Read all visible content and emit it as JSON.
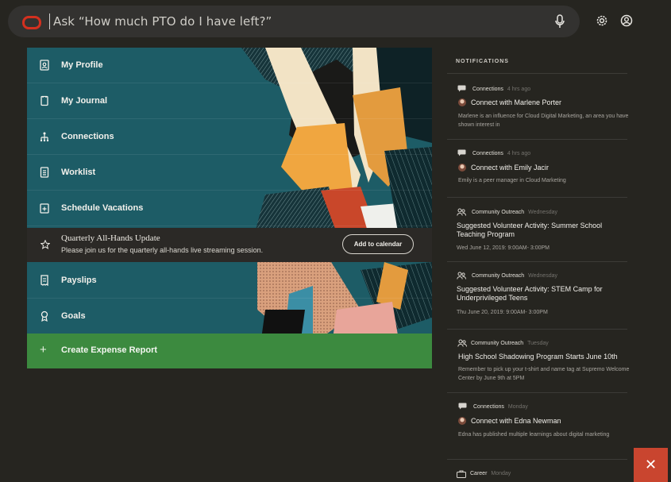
{
  "search": {
    "placeholder": "Ask “How much PTO do I have left?”"
  },
  "menu": {
    "items": [
      {
        "label": "My Profile",
        "icon": "profile-icon"
      },
      {
        "label": "My Journal",
        "icon": "journal-icon"
      },
      {
        "label": "Connections",
        "icon": "connections-icon"
      },
      {
        "label": "Worklist",
        "icon": "worklist-icon"
      },
      {
        "label": "Schedule Vacations",
        "icon": "calendar-plus-icon"
      },
      {
        "label": "Payslips",
        "icon": "payslip-icon"
      },
      {
        "label": "Goals",
        "icon": "goals-icon"
      }
    ],
    "announcement": {
      "title": "Quarterly All-Hands Update",
      "subtitle": "Please join us for the quarterly all-hands live streaming session.",
      "button": "Add to calendar"
    },
    "expense": {
      "label": "Create Expense Report",
      "icon": "plus-icon"
    }
  },
  "notifications": {
    "header": "NOTIFICATIONS",
    "items": [
      {
        "category": "Connections",
        "time": "4 hrs ago",
        "title": "Connect with Marlene Porter",
        "body": "Marlene is an influence for Cloud Digital Marketing, an area you have shown interest in"
      },
      {
        "category": "Connections",
        "time": "4 hrs ago",
        "title": "Connect with Emily Jacir",
        "body": "Emily is a peer manager in Cloud Marketing"
      },
      {
        "category": "Community Outreach",
        "time": "Wednesday",
        "title": "Suggested Volunteer Activity: Summer School Teaching Program",
        "body": "Wed June 12, 2019: 9:00AM- 3:00PM"
      },
      {
        "category": "Community Outreach",
        "time": "Wednesday",
        "title": "Suggested Volunteer Activity: STEM Camp for Underprivileged Teens",
        "body": "Thu June 20, 2019: 9:00AM- 3:00PM"
      },
      {
        "category": "Community Outreach",
        "time": "Tuesday",
        "title": "High School Shadowing Program Starts June 10th",
        "body": "Remember to pick up your t-shirt and name tag at Supremo Welcome Center by June 9th at 5PM"
      },
      {
        "category": "Connections",
        "time": "Monday",
        "title": "Connect with Edna Newman",
        "body": "Edna has published multiple learnings about digital marketing"
      },
      {
        "category": "Career",
        "time": "Monday"
      }
    ]
  },
  "close": {
    "label": "✕"
  },
  "colors": {
    "accent": "#c9452f",
    "panel": "#1d5c66",
    "expense": "#3c8a3f",
    "oracle": "#d3301f"
  }
}
